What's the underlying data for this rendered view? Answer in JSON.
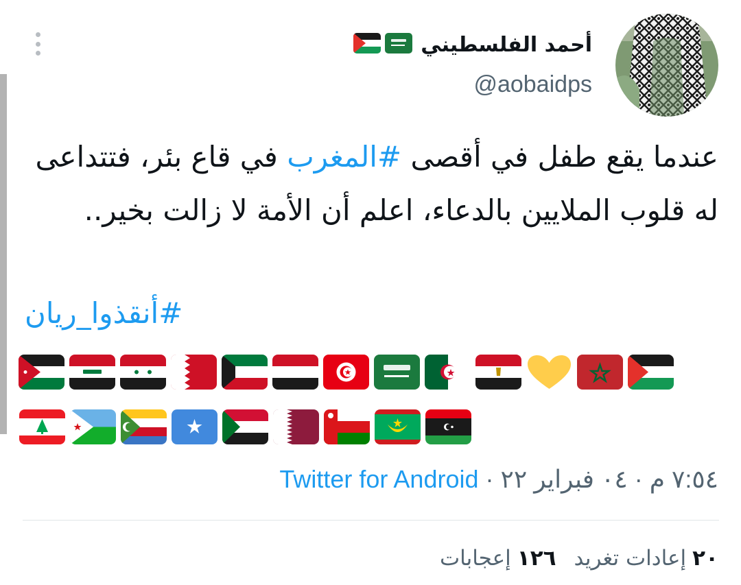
{
  "tweet": {
    "author": {
      "display_name": "أحمد الفلسطيني",
      "name_flags": [
        "saudi-arabia-flag",
        "palestine-flag"
      ],
      "handle": "@aobaidps",
      "avatar_icon": "avatar-keffiyeh"
    },
    "text": {
      "part1": "عندما يقع طفل في أقصى ",
      "hashtag1": "#المغرب",
      "part2": " في قاع بئر، فتتداعى له قلوب الملايين بالدعاء، اعلم أن الأمة لا زالت بخير..",
      "hashtag2": "#أنقذوا_ريان"
    },
    "flags_row1": [
      "palestine",
      "morocco",
      "yellow-heart",
      "egypt",
      "algeria",
      "saudi-arabia",
      "tunisia",
      "yemen",
      "kuwait",
      "bahrain",
      "syria",
      "iraq",
      "jordan"
    ],
    "flags_row2": [
      "libya",
      "mauritania",
      "oman",
      "qatar",
      "sudan",
      "somalia",
      "comoros",
      "djibouti",
      "lebanon"
    ],
    "meta": {
      "time": "٧:٥٤ م",
      "date": "٠٤ فبراير ٢٢",
      "separator": "·",
      "source": "Twitter for Android"
    },
    "stats": {
      "retweets_count": "٢٠",
      "retweets_label": "إعادات تغريد",
      "likes_count": "١٢٦",
      "likes_label": "إعجابات"
    }
  },
  "colors": {
    "link": "#1d9bf0",
    "secondary_text": "#536471",
    "primary_text": "#0f1419",
    "divider": "#e1e5e8"
  }
}
